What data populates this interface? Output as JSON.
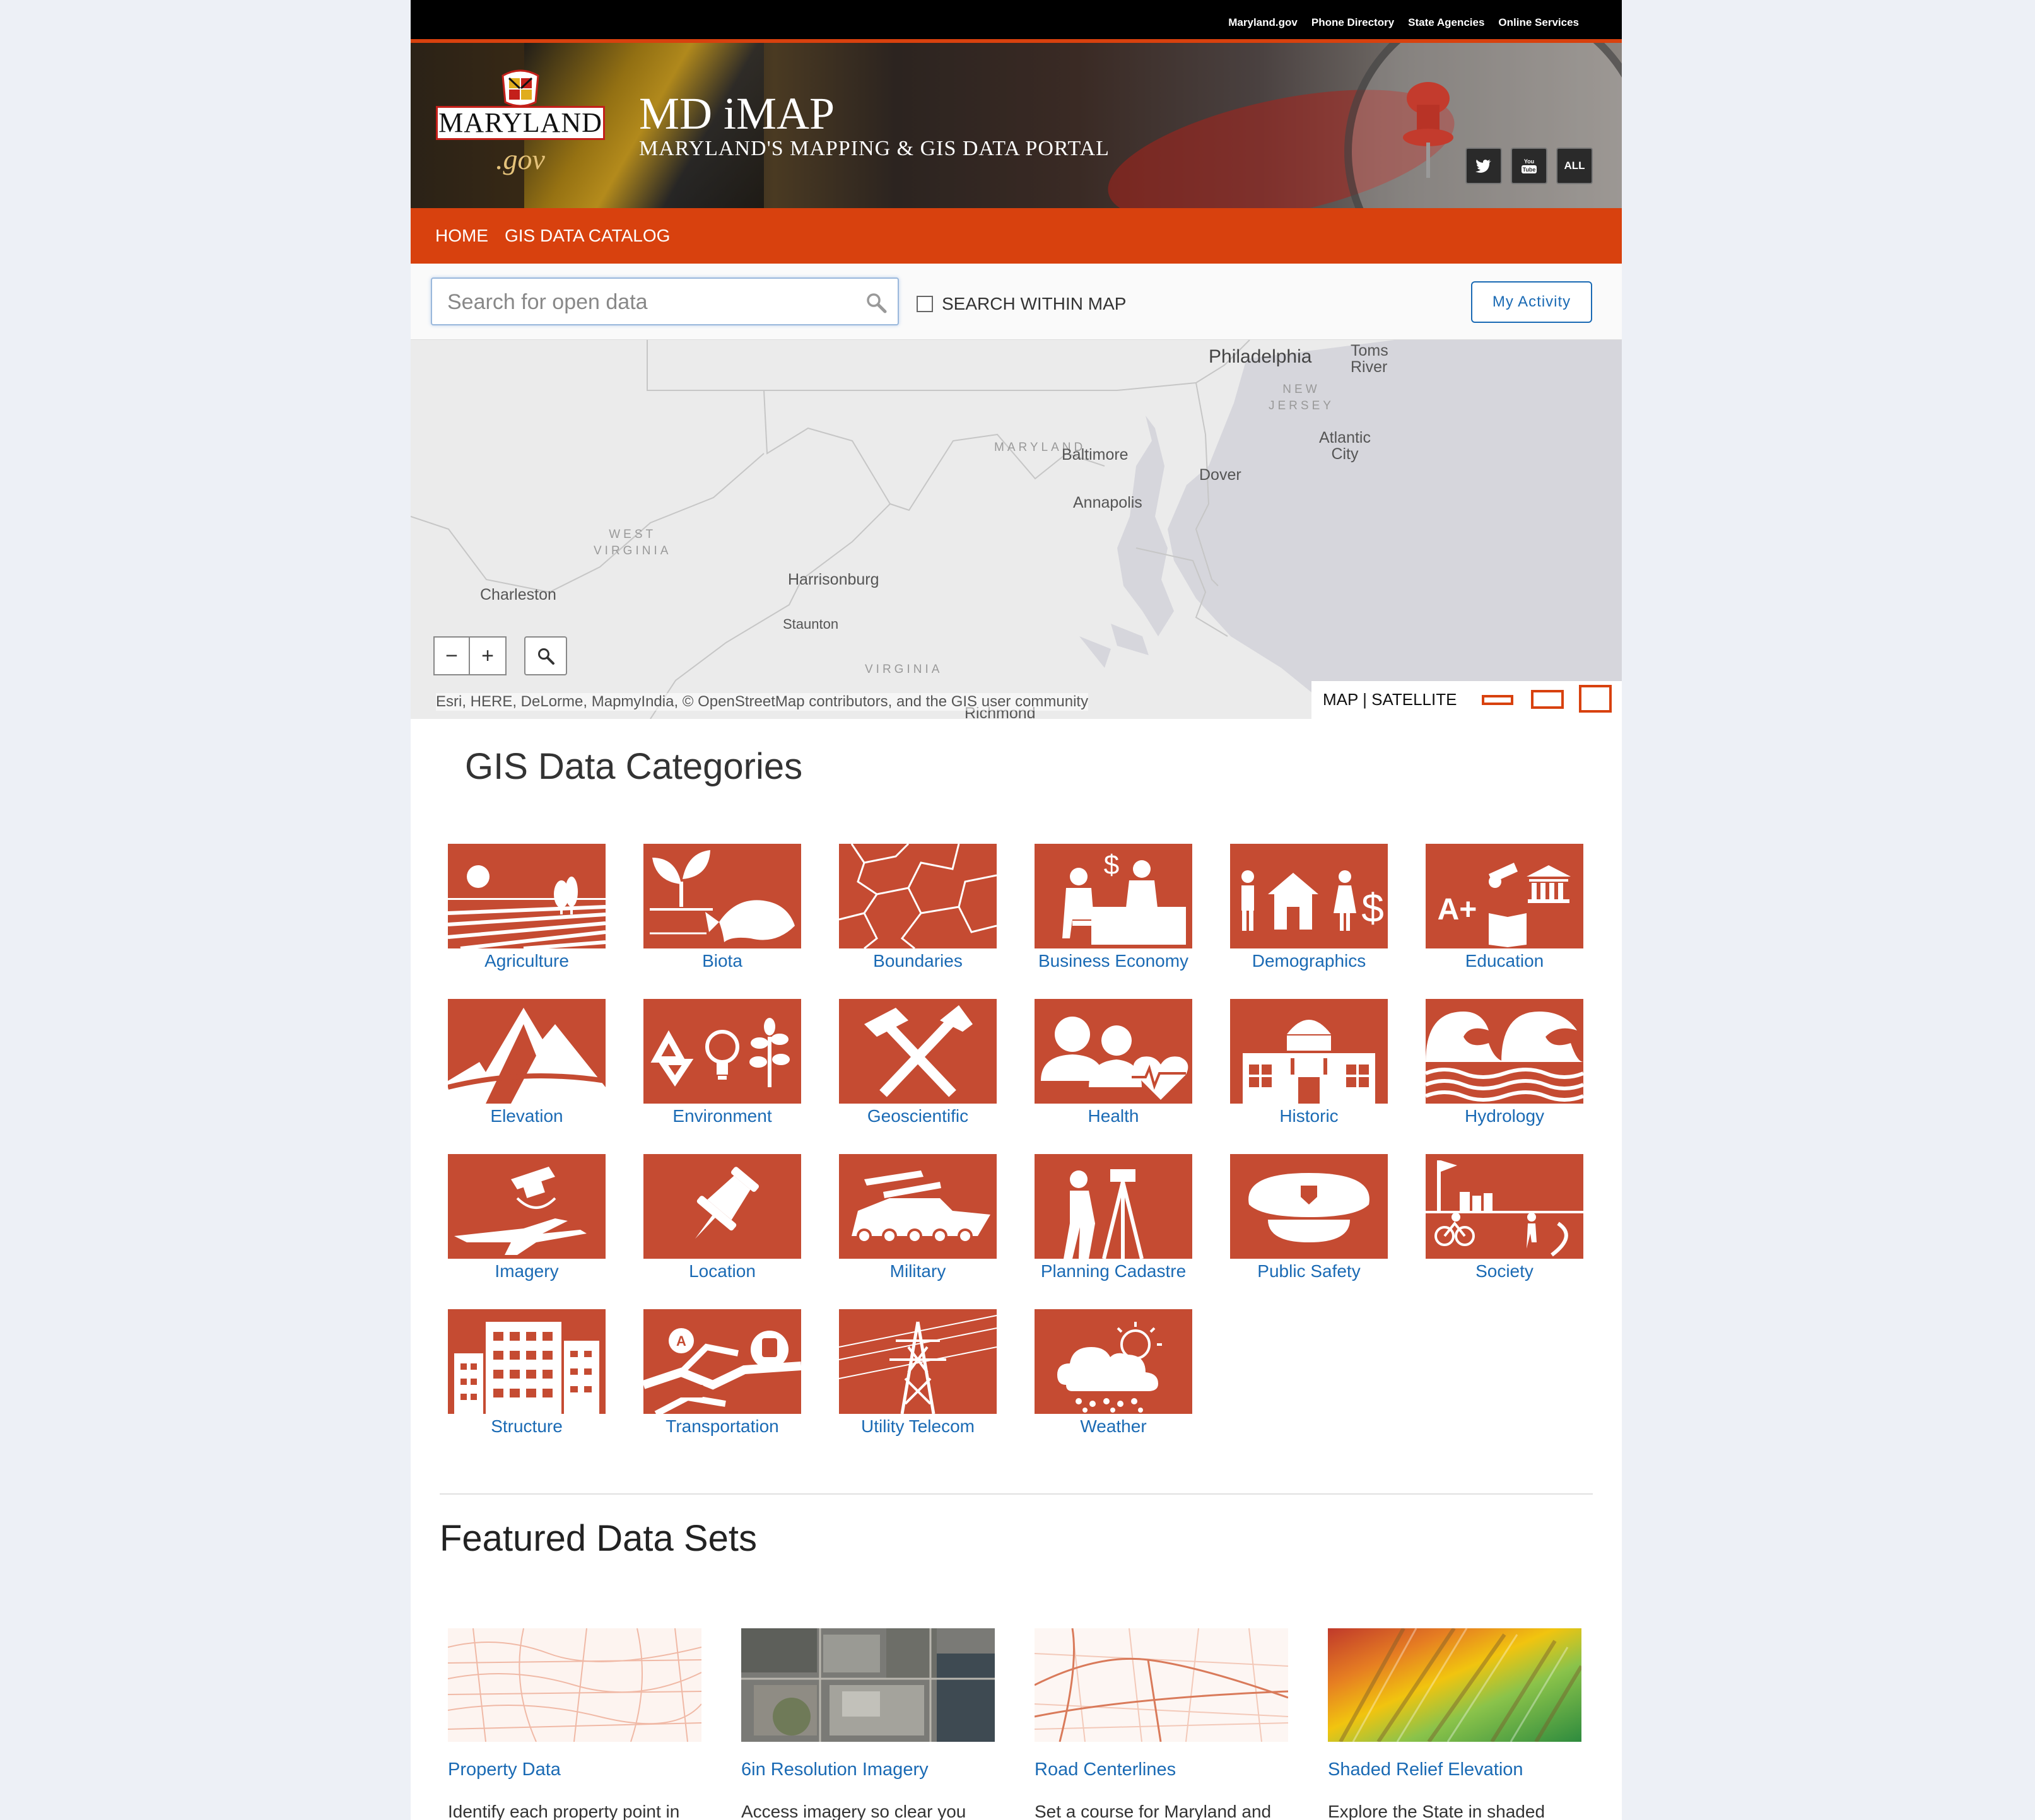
{
  "top_links": [
    "Maryland.gov",
    "Phone Directory",
    "State Agencies",
    "Online Services"
  ],
  "logo": {
    "word": "MARYLAND",
    "gov": ".gov"
  },
  "site": {
    "title": "MD iMAP",
    "subtitle": "MARYLAND'S MAPPING & GIS DATA PORTAL"
  },
  "social": [
    "twitter-icon",
    "youtube-icon",
    "ALL"
  ],
  "nav": {
    "home": "HOME",
    "catalog": "GIS DATA CATALOG"
  },
  "search": {
    "placeholder": "Search for open data",
    "within_label": "SEARCH WITHIN MAP",
    "activity_label": "My Activity"
  },
  "map": {
    "labels": {
      "philadelphia": "Philadelphia",
      "toms_river": "Toms\nRiver",
      "new_jersey": "NEW\nJERSEY",
      "atlantic_city": "Atlantic\nCity",
      "maryland": "MARYLAND",
      "baltimore": "Baltimore",
      "dover": "Dover",
      "annapolis": "Annapolis",
      "west_virginia": "WEST\nVIRGINIA",
      "charleston": "Charleston",
      "harrisonburg": "Harrisonburg",
      "staunton": "Staunton",
      "virginia": "VIRGINIA",
      "richmond": "Richmond"
    },
    "zoom_out": "−",
    "zoom_in": "+",
    "attribution": "Esri, HERE, DeLorme, MapmyIndia, © OpenStreetMap contributors, and the GIS user community",
    "basemap": {
      "map": "MAP",
      "sep": "|",
      "satellite": "SATELLITE"
    }
  },
  "categories_title": "GIS Data Categories",
  "categories": [
    "Agriculture",
    "Biota",
    "Boundaries",
    "Business Economy",
    "Demographics",
    "Education",
    "Elevation",
    "Environment",
    "Geoscientific",
    "Health",
    "Historic",
    "Hydrology",
    "Imagery",
    "Location",
    "Military",
    "Planning Cadastre",
    "Public Safety",
    "Society",
    "Structure",
    "Transportation",
    "Utility Telecom",
    "Weather"
  ],
  "featured_title": "Featured Data Sets",
  "featured": [
    {
      "name": "Property Data",
      "desc": "Identify each property point in"
    },
    {
      "name": "6in Resolution Imagery",
      "desc": "Access imagery so clear you"
    },
    {
      "name": "Road Centerlines",
      "desc": "Set a course for Maryland and"
    },
    {
      "name": "Shaded Relief Elevation",
      "desc": "Explore the State in shaded"
    }
  ],
  "colors": {
    "accent": "#d8410e",
    "tile": "#c54b32",
    "link": "#1a6ab4"
  }
}
